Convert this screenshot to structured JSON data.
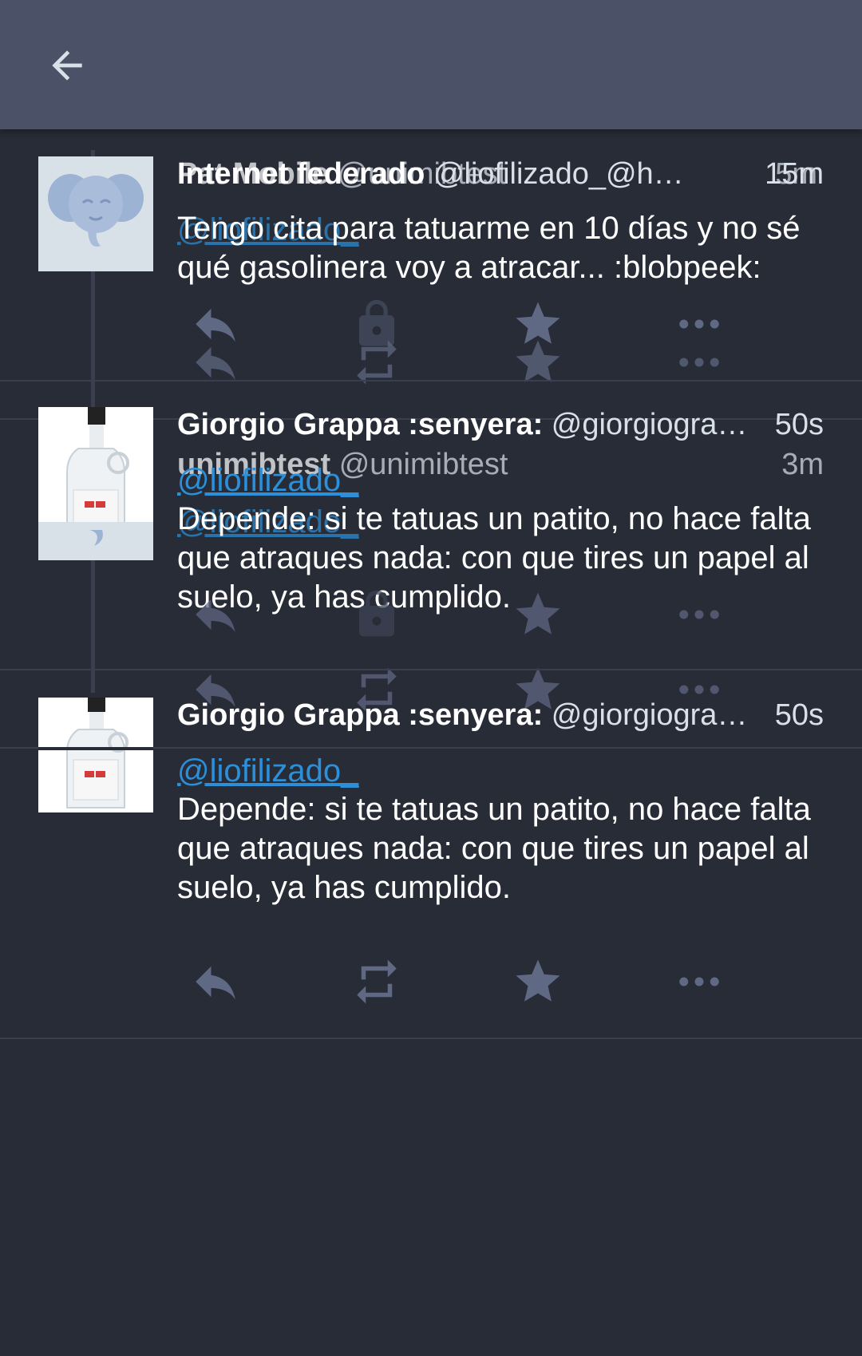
{
  "app": {
    "back_icon": "arrow-left-icon",
    "colors": {
      "background": "#282c37",
      "topbar": "#4b5166",
      "mention": "#2b90d9",
      "action_icon": "#606984",
      "separator": "#393f4f"
    }
  },
  "statuses": [
    {
      "display_name": "Pat Mobile",
      "handle": "@unimibtest",
      "time": "5m",
      "mention": "",
      "text": ""
    },
    {
      "display_name": "Internet federado",
      "handle": "@liofilizado_@h…",
      "time": "15m",
      "mention": "",
      "text": "Tengo cita para tatuarme en 10 días y no sé qué gasolinera voy a atracar... :blobpeek:"
    },
    {
      "display_name": "unimibtest",
      "handle": "@unimibtest",
      "time": "3m",
      "mention": "@liofilizado_",
      "text": ""
    },
    {
      "display_name": "Giorgio Grappa :senyera:",
      "handle": "@giorgiogra…",
      "time": "50s",
      "mention": "@liofilizado_",
      "text": "Depende: si te tatuas un patito, no hace falta que atraques nada: con que tires un papel al suelo, ya has cumplido."
    },
    {
      "display_name": "Giorgio Grappa :senyera:",
      "handle": "@giorgiogra…",
      "time": "50s",
      "mention": "@liofilizado_",
      "text": "Depende: si te tatuas un patito, no hace falta que atraques nada: con que tires un papel al suelo, ya has cumplido."
    }
  ],
  "action_icons": [
    "reply-icon",
    "boost-icon",
    "lock-icon",
    "favourite-icon",
    "more-icon"
  ]
}
